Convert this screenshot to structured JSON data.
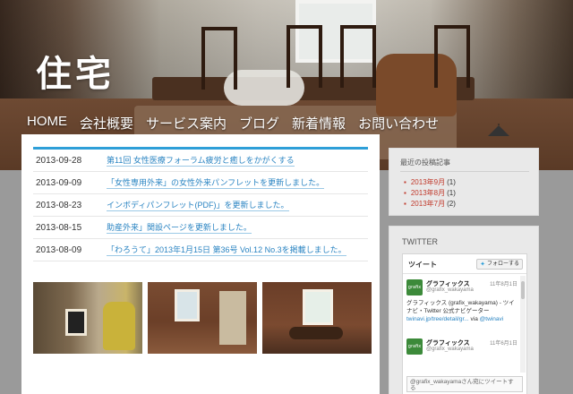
{
  "site": {
    "title": "住宅"
  },
  "nav": {
    "items": [
      {
        "label": "HOME"
      },
      {
        "label": "会社概要"
      },
      {
        "label": "サービス案内"
      },
      {
        "label": "ブログ"
      },
      {
        "label": "新着情報"
      },
      {
        "label": "お問い合わせ"
      }
    ]
  },
  "news": {
    "rows": [
      {
        "date": "2013-09-28",
        "title": "第11回 女性医療フォーラム疲労と癒しをかがくする"
      },
      {
        "date": "2013-09-09",
        "title": "「女性専用外来」の女性外来パンフレットを更新しました。"
      },
      {
        "date": "2013-08-23",
        "title": "インボディパンフレット(PDF)」を更新しました。"
      },
      {
        "date": "2013-08-15",
        "title": "助産外来」関設ページを更新しました。"
      },
      {
        "date": "2013-08-09",
        "title": "「わろうて」2013年1月15日 第36号 Vol.12 No.3を掲載しました。"
      }
    ]
  },
  "sidebar": {
    "recent": {
      "title": "最近の投稿記事",
      "items": [
        {
          "label": "2013年9月",
          "count": "(1)"
        },
        {
          "label": "2013年8月",
          "count": "(1)"
        },
        {
          "label": "2013年7月",
          "count": "(2)"
        }
      ]
    },
    "twitter": {
      "title": "TWITTER",
      "header": "ツイート",
      "follow_label": "フォローする",
      "tweets": [
        {
          "name": "グラフィックス",
          "handle": "@grafix_wakayama",
          "date": "11年8月1日",
          "text": "グラフィックス (grafix_wakayama) - ツイナビ・Twitter 公式ナビゲーター",
          "link": "twinavi.jp/tree/detail/gr...",
          "via": "via",
          "via_handle": "@twinavi"
        },
        {
          "name": "グラフィックス",
          "handle": "@grafix_wakayama",
          "date": "11年6月1日",
          "text": "",
          "link": "",
          "via": "",
          "via_handle": ""
        }
      ],
      "input_placeholder": "@grafix_wakayamaさん宛にツイートする"
    }
  },
  "colors": {
    "accent": "#2e9fd8",
    "link": "#2a84c2",
    "archive": "#c0392b"
  }
}
